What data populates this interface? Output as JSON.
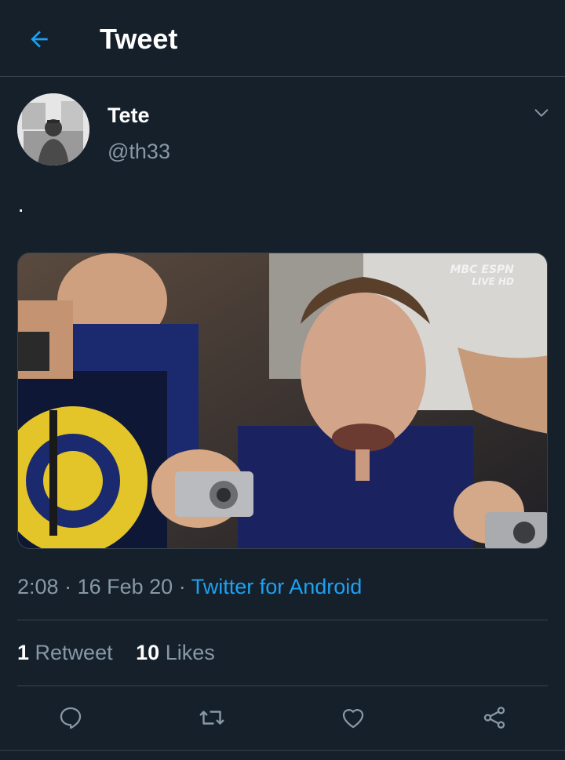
{
  "header": {
    "title": "Tweet",
    "back_icon": "arrow-left-icon"
  },
  "author": {
    "name": "Tete",
    "handle": "@th33"
  },
  "tweet": {
    "text": "·",
    "media": {
      "watermark_top": "MBC ESPN",
      "watermark_bottom": "LIVE HD"
    },
    "time": "2:08",
    "date": "16 Feb 20",
    "source": "Twitter for Android"
  },
  "stats": {
    "retweets_count": "1",
    "retweets_label": "Retweet",
    "likes_count": "10",
    "likes_label": "Likes"
  },
  "actions": [
    "reply-icon",
    "retweet-icon",
    "like-icon",
    "share-icon"
  ],
  "colors": {
    "background": "#15202b",
    "accent": "#1da1f2",
    "secondary_text": "#8899a6",
    "divider": "#38444d"
  }
}
